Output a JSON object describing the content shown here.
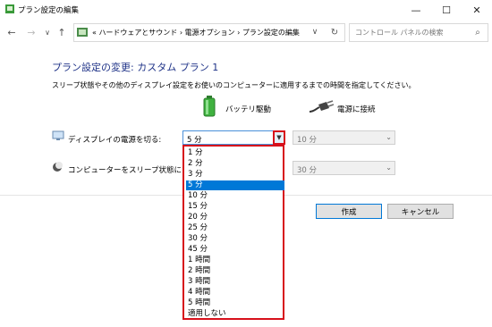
{
  "window": {
    "title": "プラン設定の編集",
    "controls": {
      "minimize": "—",
      "maximize": "☐",
      "close": "✕"
    }
  },
  "nav": {
    "back": "←",
    "forward": "→",
    "dropdown": "∨",
    "up": "↑",
    "breadcrumb": "« ハードウェアとサウンド  ›  電源オプション  ›  プラン設定の編集",
    "refresh": "↻",
    "search_placeholder": "コントロール パネルの検索"
  },
  "content": {
    "heading": "プラン設定の変更: カスタム プラン 1",
    "description": "スリープ状態やその他のディスプレイ設定をお使いのコンピューターに適用するまでの時間を指定してください。",
    "columns": {
      "on_battery": "バッテリ駆動",
      "plugged_in": "電源に接続"
    },
    "display_off": {
      "label": "ディスプレイの電源を切る:",
      "battery_value": "5 分",
      "ac_value": "10 分"
    },
    "sleep": {
      "label": "コンピューターをスリープ状態にする:",
      "ac_value": "30 分"
    },
    "buttons": {
      "create": "作成",
      "cancel": "キャンセル"
    }
  },
  "dropdown": {
    "selected": "5 分",
    "options": [
      "1 分",
      "2 分",
      "3 分",
      "5 分",
      "10 分",
      "15 分",
      "20 分",
      "25 分",
      "30 分",
      "45 分",
      "1 時間",
      "2 時間",
      "3 時間",
      "4 時間",
      "5 時間",
      "適用しない"
    ]
  },
  "colors": {
    "accent": "#0078d7",
    "highlight_border": "#d7101b",
    "heading": "#1e3287"
  }
}
